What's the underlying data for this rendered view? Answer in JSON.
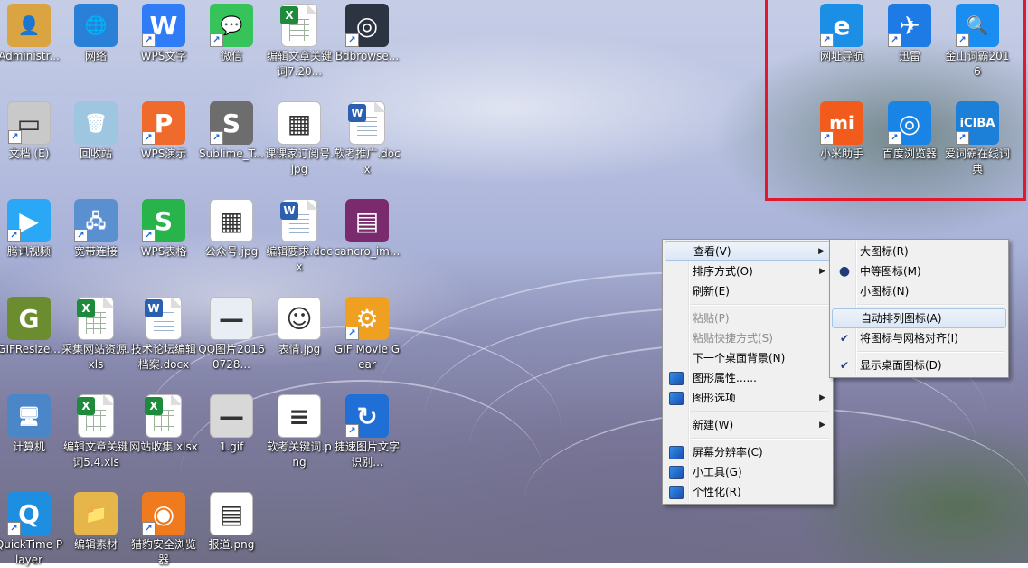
{
  "desktop": {
    "icons": [
      {
        "label": "Administr...",
        "glyph": "👤",
        "color": "#d9a441",
        "shortcut": false,
        "icon": "user-folder-icon"
      },
      {
        "label": "网络",
        "glyph": "🌐",
        "color": "#2a7fd6",
        "shortcut": false,
        "icon": "network-globe-icon"
      },
      {
        "label": "WPS文字",
        "glyph": "W",
        "color": "#2f7cf6",
        "shortcut": true,
        "icon": "wps-writer-icon"
      },
      {
        "label": "微信",
        "glyph": "💬",
        "color": "#35c35a",
        "shortcut": true,
        "icon": "wechat-icon"
      },
      {
        "label": "编辑文章关键词7.20...",
        "glyph": "X",
        "color": "#1e8a3c",
        "shortcut": false,
        "icon": "excel-file-icon"
      },
      {
        "label": "Bdbrowse...",
        "glyph": "◎",
        "color": "#2b3440",
        "shortcut": true,
        "icon": "baidu-browser-installer-icon"
      },
      {
        "label": "文档 (E)",
        "glyph": "▭",
        "color": "#c9c9c9",
        "shortcut": true,
        "icon": "drive-icon"
      },
      {
        "label": "回收站",
        "glyph": "🗑",
        "color": "#9ec6e0",
        "shortcut": false,
        "icon": "recycle-bin-icon"
      },
      {
        "label": "WPS演示",
        "glyph": "P",
        "color": "#f06a2b",
        "shortcut": true,
        "icon": "wps-presentation-icon"
      },
      {
        "label": "Sublime_T...",
        "glyph": "S",
        "color": "#6d6d6d",
        "shortcut": true,
        "icon": "sublime-installer-icon"
      },
      {
        "label": "课课家订阅号.jpg",
        "glyph": "▦",
        "color": "#ffffff",
        "shortcut": false,
        "icon": "qr-image-icon"
      },
      {
        "label": "软考推广.docx",
        "glyph": "W",
        "color": "#2b5fb0",
        "shortcut": false,
        "icon": "word-file-icon"
      },
      {
        "label": "腾讯视频",
        "glyph": "▶",
        "color": "#2aa7f5",
        "shortcut": true,
        "icon": "tencent-video-icon"
      },
      {
        "label": "宽带连接",
        "glyph": "🖧",
        "color": "#5a8fd0",
        "shortcut": true,
        "icon": "broadband-icon"
      },
      {
        "label": "WPS表格",
        "glyph": "S",
        "color": "#27b44a",
        "shortcut": true,
        "icon": "wps-spreadsheet-icon"
      },
      {
        "label": "公众号.jpg",
        "glyph": "▦",
        "color": "#ffffff",
        "shortcut": false,
        "icon": "qr-image-icon"
      },
      {
        "label": "编辑要求.docx",
        "glyph": "W",
        "color": "#2b5fb0",
        "shortcut": false,
        "icon": "word-file-icon"
      },
      {
        "label": "cancro_im...",
        "glyph": "▤",
        "color": "#7a2b6e",
        "shortcut": false,
        "icon": "winrar-archive-icon"
      },
      {
        "label": "GIFResize...",
        "glyph": "G",
        "color": "#6c8d2f",
        "shortcut": false,
        "icon": "gif-resizer-icon"
      },
      {
        "label": "采集网站资源.xls",
        "glyph": "X",
        "color": "#1e8a3c",
        "shortcut": false,
        "icon": "excel-file-icon"
      },
      {
        "label": "技术论坛编辑档案.docx",
        "glyph": "W",
        "color": "#2b5fb0",
        "shortcut": false,
        "icon": "word-file-icon"
      },
      {
        "label": "QQ图片20160728...",
        "glyph": "—",
        "color": "#e9eef5",
        "shortcut": false,
        "icon": "image-file-icon"
      },
      {
        "label": "表情.jpg",
        "glyph": "☺",
        "color": "#ffffff",
        "shortcut": false,
        "icon": "image-file-icon"
      },
      {
        "label": "GIF Movie Gear",
        "glyph": "⚙",
        "color": "#f0a020",
        "shortcut": true,
        "icon": "gif-movie-gear-icon"
      },
      {
        "label": "计算机",
        "glyph": "🖥",
        "color": "#4a86c8",
        "shortcut": false,
        "icon": "computer-icon"
      },
      {
        "label": "编辑文章关键词5.4.xls",
        "glyph": "X",
        "color": "#1e8a3c",
        "shortcut": false,
        "icon": "excel-file-icon"
      },
      {
        "label": "网站收集.xlsx",
        "glyph": "X",
        "color": "#1e8a3c",
        "shortcut": false,
        "icon": "excel-file-icon"
      },
      {
        "label": "1.gif",
        "glyph": "—",
        "color": "#d8d8d8",
        "shortcut": false,
        "icon": "gif-file-icon"
      },
      {
        "label": "软考关键词.png",
        "glyph": "≡",
        "color": "#ffffff",
        "shortcut": false,
        "icon": "image-file-icon"
      },
      {
        "label": "捷速图片文字识别...",
        "glyph": "↻",
        "color": "#1f6fd6",
        "shortcut": true,
        "icon": "ocr-app-icon"
      },
      {
        "label": "QuickTime Player",
        "glyph": "Q",
        "color": "#1e8ee0",
        "shortcut": true,
        "icon": "quicktime-icon"
      },
      {
        "label": "编辑素材",
        "glyph": "📁",
        "color": "#e6b64a",
        "shortcut": false,
        "icon": "folder-icon"
      },
      {
        "label": "猎豹安全浏览器",
        "glyph": "◉",
        "color": "#f07a1e",
        "shortcut": true,
        "icon": "liebao-browser-icon"
      },
      {
        "label": "报道.png",
        "glyph": "▤",
        "color": "#ffffff",
        "shortcut": false,
        "icon": "image-file-icon"
      }
    ],
    "highlight_icons": [
      {
        "label": "网址导航",
        "glyph": "e",
        "color": "#1b8ee6",
        "icon": "ie-browser-icon"
      },
      {
        "label": "迅雷",
        "glyph": "✈",
        "color": "#1e7be6",
        "icon": "xunlei-icon"
      },
      {
        "label": "金山词霸2016",
        "glyph": "🔍",
        "color": "#1a8ef0",
        "icon": "kingsoft-dict-icon"
      },
      {
        "label": "小米助手",
        "glyph": "mi",
        "color": "#f25b1c",
        "icon": "mi-assistant-icon"
      },
      {
        "label": "百度浏览器",
        "glyph": "◎",
        "color": "#1a84e6",
        "icon": "baidu-browser-icon"
      },
      {
        "label": "爱词霸在线词典",
        "glyph": "iCIBA",
        "color": "#1c7fd8",
        "icon": "iciba-icon"
      }
    ]
  },
  "context_menu": {
    "items": [
      {
        "label": "查看(V)",
        "submenu": true,
        "disabled": false,
        "hover": true
      },
      {
        "label": "排序方式(O)",
        "submenu": true,
        "disabled": false
      },
      {
        "label": "刷新(E)",
        "submenu": false,
        "disabled": false
      },
      {
        "label": "粘贴(P)",
        "submenu": false,
        "disabled": true
      },
      {
        "label": "粘贴快捷方式(S)",
        "submenu": false,
        "disabled": true
      },
      {
        "label": "下一个桌面背景(N)",
        "submenu": false,
        "disabled": false
      },
      {
        "label": "图形属性......",
        "submenu": false,
        "disabled": false,
        "icon": "graphics-properties-icon"
      },
      {
        "label": "图形选项",
        "submenu": true,
        "disabled": false,
        "icon": "graphics-options-icon"
      },
      {
        "label": "新建(W)",
        "submenu": true,
        "disabled": false
      },
      {
        "label": "屏幕分辨率(C)",
        "submenu": false,
        "disabled": false,
        "icon": "screen-resolution-icon"
      },
      {
        "label": "小工具(G)",
        "submenu": false,
        "disabled": false,
        "icon": "gadgets-icon"
      },
      {
        "label": "个性化(R)",
        "submenu": false,
        "disabled": false,
        "icon": "personalize-icon"
      }
    ]
  },
  "view_submenu": {
    "items": [
      {
        "label": "大图标(R)",
        "mark": ""
      },
      {
        "label": "中等图标(M)",
        "mark": "●"
      },
      {
        "label": "小图标(N)",
        "mark": ""
      },
      {
        "label": "自动排列图标(A)",
        "mark": "",
        "hover": true
      },
      {
        "label": "将图标与网格对齐(I)",
        "mark": "✔"
      },
      {
        "label": "显示桌面图标(D)",
        "mark": "✔"
      }
    ]
  },
  "colors": {
    "highlight_border": "#e3182d",
    "menu_bg": "#f0f0f0",
    "menu_hover": "#dbe7f6"
  }
}
